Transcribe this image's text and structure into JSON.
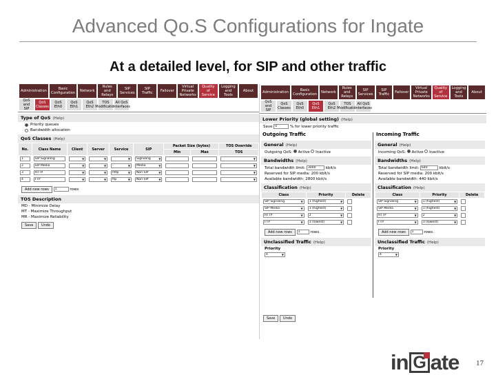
{
  "slide": {
    "title": "Advanced Qo.S Configurations for Ingate",
    "subtitle": "At a detailed level, for SIP and other traffic",
    "page_number": "17",
    "logo": {
      "left": "in",
      "g": "G",
      "right": "ate"
    }
  },
  "nav_tabs": [
    "Administration",
    "Basic\nConfiguration",
    "Network",
    "Rules and\nRelays",
    "SIP\nServices",
    "SIP\nTraffic",
    "Failover",
    "Virtual Private\nNetworks",
    "Quality of\nService",
    "Logging\nand Tools",
    "About"
  ],
  "sub_tabs": [
    "QoS and\nSIP",
    "QoS\nClasses",
    "QoS\nEth0",
    "QoS\nEth1",
    "QoS\nEth2",
    "TOS\nModification",
    "All QoS\nInterfaces"
  ],
  "shotA": {
    "type_head": "Type of QoS",
    "help": "(Help)",
    "type_options": [
      "Priority queues",
      "Bandwidth allocation"
    ],
    "classes_head": "QoS Classes",
    "columns": [
      "No.",
      "Class Name",
      "Client",
      "Server",
      "Service",
      "SIP",
      "Packet Size (bytes)",
      "TOS Override"
    ],
    "packet_sub": [
      "Min",
      "Max",
      "TOS"
    ],
    "rows": [
      {
        "no": "1",
        "name": "SIP Signaling",
        "sip": "Signaling"
      },
      {
        "no": "2",
        "name": "SIP Media",
        "service": "-",
        "sip": "Media"
      },
      {
        "no": "3",
        "name": "HTTP",
        "service": "http",
        "sip": "Non-SIP"
      },
      {
        "no": "4",
        "name": "FTP",
        "service": "ftp",
        "sip": "Non-SIP"
      }
    ],
    "add_rows": "Add new rows",
    "add_count": "1",
    "rows_word": "rows",
    "tos_head": "TOS Description",
    "tos_lines": [
      "MD - Minimize Delay",
      "MT - Maximize Throughput",
      "MR - Maximize Reliability"
    ],
    "save": "Save",
    "undo": "Undo"
  },
  "shotB": {
    "lower_priority_head": "Lower Priority (global setting)",
    "help": "(Help)",
    "save_label": "Save",
    "save_value": "0",
    "percent_text": "% for lower priority traffic",
    "outgoing": {
      "head": "Outgoing Traffic",
      "general": "General",
      "qos_label": "Outgoing QoS:",
      "active": "Active",
      "inactive": "Inactive",
      "bandwidths": "Bandwidths",
      "limit_label": "Total bandwidth limit:",
      "limit_value": "3000",
      "unit": "kbit/s",
      "reserved": "Reserved for SIP media: 200 kbit/s",
      "available": "Available bandwidth: 2800 kbit/s",
      "classification": "Classification",
      "unclassified": "Unclassified Traffic",
      "priority": "Priority",
      "priority_value": "4"
    },
    "incoming": {
      "head": "Incoming Traffic",
      "general": "General",
      "qos_label": "Incoming QoS:",
      "active": "Active",
      "inactive": "Inactive",
      "bandwidths": "Bandwidths",
      "limit_label": "Total bandwidth limit:",
      "limit_value": "640",
      "unit": "kbit/s",
      "reserved": "Reserved for SIP media: 200 kbit/s",
      "available": "Available bandwidth: 440 kbit/s",
      "classification": "Classification",
      "unclassified": "Unclassified Traffic",
      "priority": "Priority",
      "priority_value": "4"
    },
    "class_cols": [
      "Class",
      "Priority",
      "Delete"
    ],
    "class_rows": [
      {
        "cls": "SIP Signaling",
        "prio": "1 (highest)"
      },
      {
        "cls": "SIP Media",
        "prio": "1 (highest)"
      },
      {
        "cls": "HTTP",
        "prio": "2"
      },
      {
        "cls": "FTP",
        "prio": "3 (lowest)"
      }
    ],
    "add_rows": "Add new rows",
    "add_count": "1",
    "rows_word": "rows.",
    "save": "Save",
    "undo": "Undo"
  }
}
